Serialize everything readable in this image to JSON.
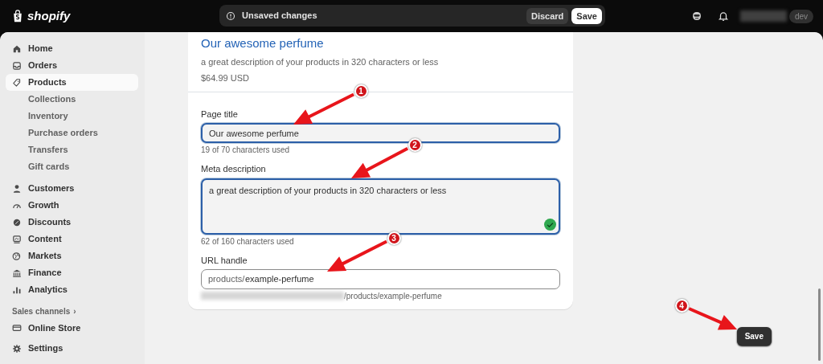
{
  "topbar": {
    "logo": "shopify",
    "status": "Unsaved changes",
    "buttons": [
      {
        "label": "Discard",
        "kind": "secondary"
      },
      {
        "label": "Save",
        "kind": "primary"
      }
    ],
    "store_badge": "dev"
  },
  "sidebar": {
    "items": [
      {
        "label": "Home",
        "kind": "main",
        "selected": false
      },
      {
        "label": "Orders",
        "kind": "main",
        "selected": false
      },
      {
        "label": "Products",
        "kind": "main",
        "selected": true
      },
      {
        "label": "Collections",
        "kind": "sub",
        "selected": false
      },
      {
        "label": "Inventory",
        "kind": "sub",
        "selected": false
      },
      {
        "label": "Purchase orders",
        "kind": "sub",
        "selected": false
      },
      {
        "label": "Transfers",
        "kind": "sub",
        "selected": false
      },
      {
        "label": "Gift cards",
        "kind": "sub",
        "selected": false
      },
      {
        "label": "Customers",
        "kind": "main",
        "selected": false
      },
      {
        "label": "Growth",
        "kind": "main",
        "selected": false
      },
      {
        "label": "Discounts",
        "kind": "main",
        "selected": false
      },
      {
        "label": "Content",
        "kind": "main",
        "selected": false
      },
      {
        "label": "Markets",
        "kind": "main",
        "selected": false
      },
      {
        "label": "Finance",
        "kind": "main",
        "selected": false
      },
      {
        "label": "Analytics",
        "kind": "main",
        "selected": false
      },
      {
        "label": "Sales channels",
        "kind": "section",
        "chevron": "›",
        "selected": false
      },
      {
        "label": "Online Store",
        "kind": "main",
        "selected": false
      }
    ],
    "footer": {
      "label": "Settings"
    }
  },
  "preview": {
    "title": "Our awesome perfume",
    "description": "a great description of your products in 320 characters or less",
    "price": "$64.99 USD"
  },
  "fields": [
    {
      "label": "Page title",
      "kind": "input",
      "value": "Our awesome perfume",
      "focused": true,
      "help": "19 of 70 characters used"
    },
    {
      "label": "Meta description",
      "kind": "textarea",
      "value": "a great description of your products in 320 characters or less",
      "focused": true,
      "valid": true,
      "help": "62 of 160 characters used"
    },
    {
      "label": "URL handle",
      "kind": "prefixed",
      "prefix": "products/",
      "value": "example-perfume",
      "focused": false,
      "help": "/products/example-perfume"
    }
  ],
  "save_button": "Save",
  "annotations": [
    {
      "number": "1"
    },
    {
      "number": "2"
    },
    {
      "number": "3"
    },
    {
      "number": "4"
    }
  ]
}
